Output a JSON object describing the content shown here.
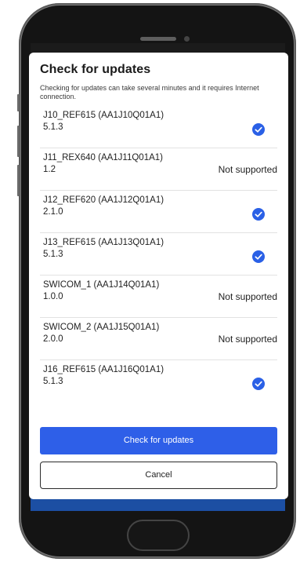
{
  "dialog": {
    "title": "Check for updates",
    "subtitle": "Checking for updates can take several minutes and it requires Internet connection.",
    "primary_button": "Check for updates",
    "secondary_button": "Cancel"
  },
  "devices": [
    {
      "name": "J10_REF615 (AA1J10Q01A1)",
      "version": "5.1.3",
      "status": "checked"
    },
    {
      "name": "J11_REX640 (AA1J11Q01A1)",
      "version": "1.2",
      "status": "Not supported"
    },
    {
      "name": "J12_REF620 (AA1J12Q01A1)",
      "version": "2.1.0",
      "status": "checked"
    },
    {
      "name": "J13_REF615 (AA1J13Q01A1)",
      "version": "5.1.3",
      "status": "checked"
    },
    {
      "name": "SWICOM_1 (AA1J14Q01A1)",
      "version": "1.0.0",
      "status": "Not supported"
    },
    {
      "name": "SWICOM_2 (AA1J15Q01A1)",
      "version": "2.0.0",
      "status": "Not supported"
    },
    {
      "name": "J16_REF615 (AA1J16Q01A1)",
      "version": "5.1.3",
      "status": "checked"
    }
  ],
  "icons": {
    "check": "check-circle-icon"
  },
  "colors": {
    "accent": "#2e5fe8",
    "check": "#2a60e6",
    "text": "#1f1f1f"
  }
}
